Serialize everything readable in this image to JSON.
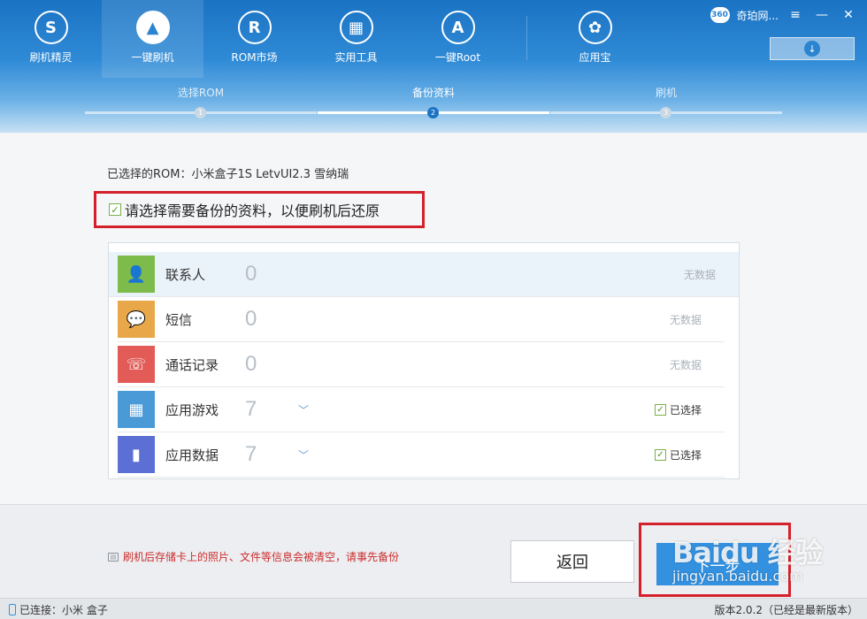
{
  "nav": {
    "items": [
      {
        "label": "刷机精灵",
        "icon": "shield-icon",
        "glyph": "S"
      },
      {
        "label": "一键刷机",
        "icon": "cursor-icon",
        "glyph": "▲"
      },
      {
        "label": "ROM市场",
        "icon": "rom-icon",
        "glyph": "R"
      },
      {
        "label": "实用工具",
        "icon": "grid-icon",
        "glyph": "▦"
      },
      {
        "label": "一键Root",
        "icon": "android-icon",
        "glyph": "A"
      },
      {
        "label": "应用宝",
        "icon": "app-store-icon",
        "glyph": "✿"
      }
    ],
    "active_index": 1
  },
  "window": {
    "username": "奇珀网...",
    "avatar_text": "360",
    "menu_glyph": "≡",
    "minimize_glyph": "—",
    "close_glyph": "✕",
    "download_glyph": "↓"
  },
  "steps": [
    {
      "label": "选择ROM",
      "num": "1"
    },
    {
      "label": "备份资料",
      "num": "2"
    },
    {
      "label": "刷机",
      "num": "3"
    }
  ],
  "main": {
    "rom_line": "已选择的ROM：小米盒子1S LetvUI2.3 雪纳瑞",
    "hint": "请选择需要备份的资料，以便刷机后还原",
    "check_glyph": "✓"
  },
  "rows": [
    {
      "name": "联系人",
      "count": "0",
      "status": "无数据",
      "color": "#7dbb4a",
      "icon": "contact-icon",
      "glyph": "👤",
      "chevron": ""
    },
    {
      "name": "短信",
      "count": "0",
      "status": "无数据",
      "color": "#e8a84a",
      "icon": "sms-icon",
      "glyph": "💬",
      "chevron": ""
    },
    {
      "name": "通话记录",
      "count": "0",
      "status": "无数据",
      "color": "#e25b57",
      "icon": "phone-call-icon",
      "glyph": "☏",
      "chevron": ""
    },
    {
      "name": "应用游戏",
      "count": "7",
      "status": "已选择",
      "color": "#4a9ad8",
      "icon": "apps-icon",
      "glyph": "▦",
      "chevron": "﹀"
    },
    {
      "name": "应用数据",
      "count": "7",
      "status": "已选择",
      "color": "#5b6fd4",
      "icon": "app-data-icon",
      "glyph": "▮",
      "chevron": "﹀"
    }
  ],
  "footer": {
    "warning": "刷机后存储卡上的照片、文件等信息会被清空，请事先备份",
    "back_label": "返回",
    "next_label": "下一步"
  },
  "watermark": {
    "logo": "Baidu 经验",
    "url": "jingyan.baidu.com"
  },
  "statusbar": {
    "connected": "已连接：小米 盒子",
    "version": "版本2.0.2（已经是最新版本）"
  }
}
